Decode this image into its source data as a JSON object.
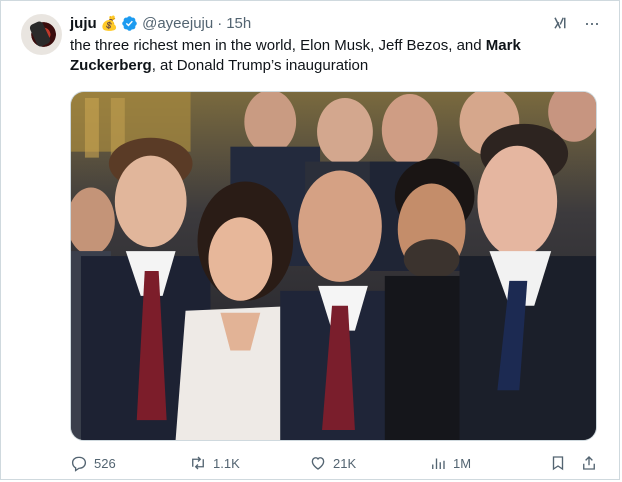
{
  "tweet": {
    "author_name": "juju",
    "author_emoji": "💰",
    "handle": "@ayeejuju",
    "separator": "·",
    "time": "15h",
    "text_part1": "the three richest men in the world, Elon Musk, Jeff Bezos, and ",
    "text_bold": "Mark Zuckerberg",
    "text_part2": ", at Donald Trump’s inauguration",
    "verified_color": "#1d9bf0"
  },
  "actions": {
    "replies": "526",
    "reposts": "1.1K",
    "likes": "21K",
    "views": "1M"
  },
  "icons": {
    "reply": "reply-icon",
    "repost": "repost-icon",
    "like": "heart-icon",
    "views": "views-icon",
    "bookmark": "bookmark-icon",
    "share": "share-icon",
    "grok": "grok-icon",
    "more": "more-icon"
  }
}
